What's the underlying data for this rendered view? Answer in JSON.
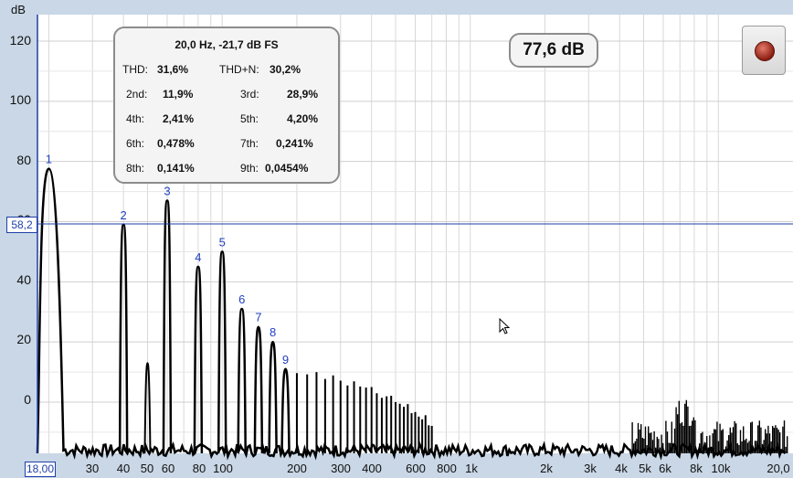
{
  "axis": {
    "unit": "dB",
    "y_ticks": [
      "120",
      "100",
      "80",
      "60",
      "40",
      "20",
      "0"
    ],
    "x_ticks": [
      "30",
      "40",
      "50",
      "60",
      "80",
      "100",
      "200",
      "300",
      "400",
      "600",
      "800",
      "1k",
      "2k",
      "3k",
      "4k",
      "5k",
      "6k",
      "8k",
      "10k",
      "20,0"
    ]
  },
  "cursor": {
    "level_label": "58,2",
    "frequency_label": "18,00"
  },
  "level_readout": "77,6 dB",
  "harmonics_panel": {
    "header": "20,0 Hz, -21,7 dB FS",
    "thd_label": "THD:",
    "thd_value": "31,6%",
    "thdn_label": "THD+N:",
    "thdn_value": "30,2%",
    "rows": [
      {
        "l1": "2nd:",
        "v1": "11,9%",
        "l2": "3rd:",
        "v2": "28,9%"
      },
      {
        "l1": "4th:",
        "v1": "2,41%",
        "l2": "5th:",
        "v2": "4,20%"
      },
      {
        "l1": "6th:",
        "v1": "0,478%",
        "l2": "7th:",
        "v2": "0,241%"
      },
      {
        "l1": "8th:",
        "v1": "0,141%",
        "l2": "9th:",
        "v2": "0,0454%"
      }
    ]
  },
  "harmonic_markers": [
    "1",
    "2",
    "3",
    "4",
    "5",
    "6",
    "7",
    "8",
    "9"
  ],
  "colors": {
    "plot_bg": "#ffffff",
    "grid": "#d8d8d8",
    "cursor": "#1f3fa8",
    "trace": "#000000",
    "frame": "#c9d7e6"
  },
  "icons": {
    "record": "record-dot-icon"
  },
  "chart_data": {
    "type": "line",
    "xscale": "log",
    "ylabel": "dB",
    "ylim": [
      -20,
      128
    ],
    "xlim": [
      18,
      20000
    ],
    "harmonic_peaks": [
      {
        "label": "1",
        "freq": 20,
        "db": 77.6
      },
      {
        "label": "2",
        "freq": 40,
        "db": 59
      },
      {
        "label": "3",
        "freq": 60,
        "db": 67
      },
      {
        "label": "4",
        "freq": 80,
        "db": 45
      },
      {
        "label": "5",
        "freq": 100,
        "db": 50
      },
      {
        "label": "6",
        "freq": 120,
        "db": 31
      },
      {
        "label": "7",
        "freq": 140,
        "db": 25
      },
      {
        "label": "8",
        "freq": 160,
        "db": 20
      },
      {
        "label": "9",
        "freq": 180,
        "db": 11
      }
    ],
    "grid": true
  }
}
